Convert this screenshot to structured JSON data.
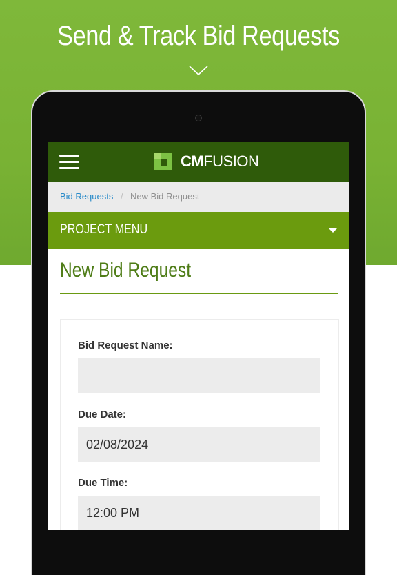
{
  "headline": "Send & Track Bid Requests",
  "colors": {
    "hero_green": "#7ab535",
    "appbar_dark_green": "#2f5b0a",
    "menu_green": "#6b9b0e",
    "title_green": "#4f7d18",
    "link_blue": "#2a8bc9"
  },
  "icons": {
    "chevron": "chevron-down-icon",
    "menu": "hamburger-menu-icon",
    "logo": "cmfusion-logo-mark",
    "caret": "caret-down-icon"
  },
  "app": {
    "logo_bold": "CM",
    "logo_light": "FUSION"
  },
  "breadcrumb": {
    "link": "Bid Requests",
    "separator": "/",
    "current": "New Bid Request"
  },
  "project_menu": {
    "label": "PROJECT MENU"
  },
  "page": {
    "title": "New Bid Request"
  },
  "form": {
    "fields": [
      {
        "label": "Bid Request Name:",
        "value": ""
      },
      {
        "label": "Due Date:",
        "value": "02/08/2024"
      },
      {
        "label": "Due Time:",
        "value": "12:00 PM"
      }
    ]
  }
}
